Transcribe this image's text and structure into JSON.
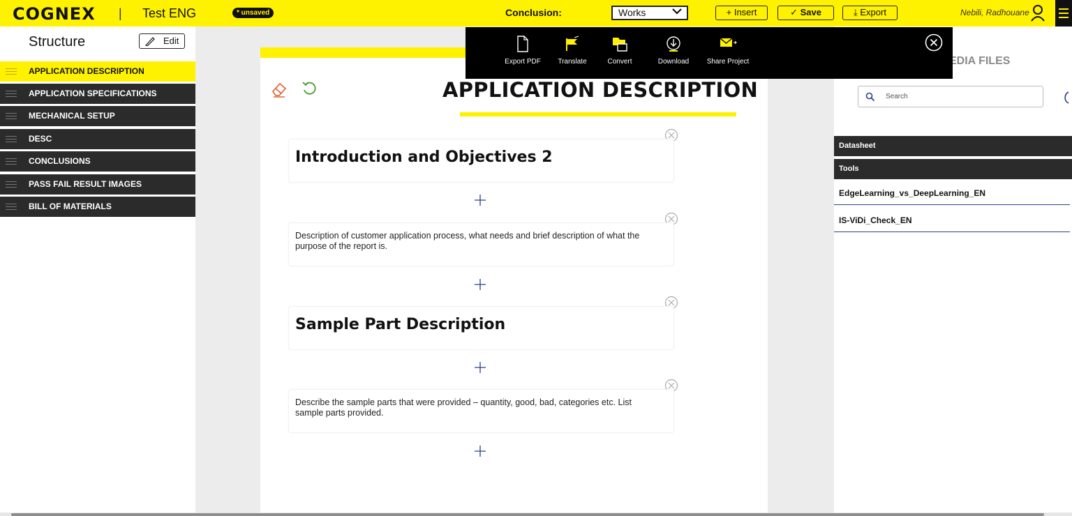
{
  "header": {
    "logo": "COGNEX",
    "separator": "|",
    "project_name": "Test ENG",
    "status_badge": "* unsaved",
    "conclusion_label": "Conclusion:",
    "conclusion_value": "Works",
    "insert_label": "+ Insert",
    "save_label": "✓ Save",
    "export_label": "⤓ Export",
    "user_name": "Nebili, Radhouane",
    "brand_color": "#fff200"
  },
  "sidebar": {
    "title": "Structure",
    "edit_label": "Edit",
    "items": [
      {
        "label": "APPLICATION DESCRIPTION",
        "active": true
      },
      {
        "label": "APPLICATION SPECIFICATIONS"
      },
      {
        "label": "MECHANICAL SETUP"
      },
      {
        "label": "DESC"
      },
      {
        "label": "CONCLUSIONS"
      },
      {
        "label": "PASS FAIL RESULT IMAGES"
      },
      {
        "label": "BILL OF MATERIALS"
      }
    ]
  },
  "overlay": {
    "items": [
      {
        "label": "Export PDF",
        "icon": "file-icon"
      },
      {
        "label": "Translate",
        "icon": "flag-icon"
      },
      {
        "label": "Convert",
        "icon": "folder-convert-icon"
      },
      {
        "label": "Download",
        "icon": "download-icon"
      },
      {
        "label": "Share Project",
        "icon": "mail-share-icon"
      }
    ]
  },
  "main": {
    "section_title": "APPLICATION DESCRIPTION",
    "blocks": [
      {
        "type": "heading",
        "text": "Introduction and Objectives 2"
      },
      {
        "type": "paragraph",
        "text": "Description of customer application process, what needs and brief description of what the purpose of the report is."
      },
      {
        "type": "heading",
        "text": "Sample Part Description"
      },
      {
        "type": "paragraph",
        "text": "Describe the sample parts that were provided – quantity, good, bad, categories etc. List sample parts provided."
      }
    ]
  },
  "right_panel": {
    "title_partial": "EDIA FILES",
    "search_placeholder": "Search",
    "categories": [
      "Datasheet",
      "Tools"
    ],
    "files": [
      "EdgeLearning_vs_DeepLearning_EN",
      "IS-ViDi_Check_EN"
    ]
  }
}
